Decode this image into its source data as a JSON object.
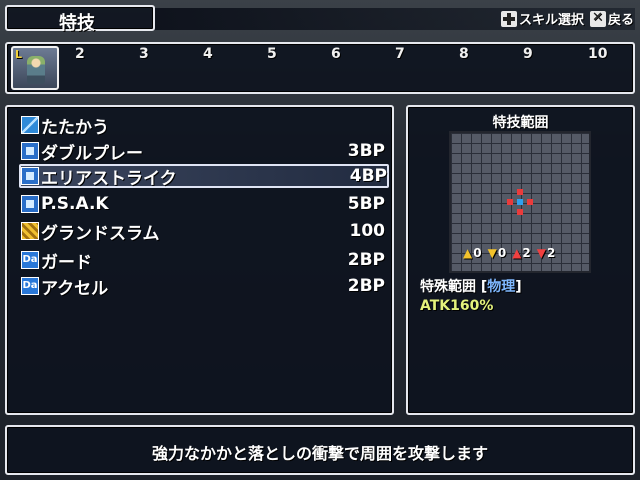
{
  "header": {
    "title": "特技",
    "help": [
      {
        "icon": "dpad-icon",
        "label": "スキル選択"
      },
      {
        "icon": "x-button-icon",
        "label": "戻る"
      }
    ]
  },
  "party": {
    "leader_mark": "L",
    "slots": [
      "2",
      "3",
      "4",
      "5",
      "6",
      "7",
      "8",
      "9",
      "10"
    ]
  },
  "skills": [
    {
      "icon": "sword-icon",
      "name": "たたかう",
      "cost": ""
    },
    {
      "icon": "skill-icon",
      "name": "ダブルプレー",
      "cost": "3BP"
    },
    {
      "icon": "skill-icon",
      "name": "エリアストライク",
      "cost": "4BP",
      "selected": true
    },
    {
      "icon": "skill-icon",
      "name": "P.S.A.K",
      "cost": "5BP"
    },
    {
      "icon": "gold-skill-icon",
      "name": "グランドスラム",
      "cost": "100"
    },
    {
      "icon": "da-icon",
      "name": "ガード",
      "cost": "2BP"
    },
    {
      "icon": "da-icon",
      "name": "アクセル",
      "cost": "2BP"
    }
  ],
  "range": {
    "title": "特技範囲",
    "heights": [
      {
        "icon": "up-yellow-arrow-icon",
        "value": "0"
      },
      {
        "icon": "down-yellow-arrow-icon",
        "value": "0"
      },
      {
        "icon": "up-red-arrow-icon",
        "value": "2"
      },
      {
        "icon": "down-red-arrow-icon",
        "value": "2"
      }
    ],
    "range_label": "特殊範囲",
    "element": "物理",
    "bracket_open": "[",
    "bracket_close": "]",
    "stat": "ATK160%"
  },
  "description": "強力なかかと落としの衝撃で周囲を攻撃します"
}
